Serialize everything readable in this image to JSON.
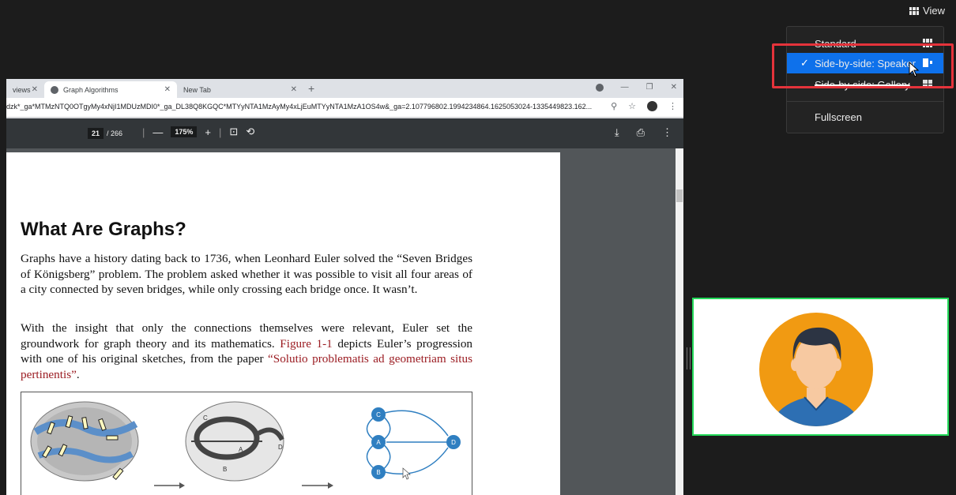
{
  "view_button": {
    "label": "View"
  },
  "view_menu": {
    "items": [
      {
        "label": "Standard"
      },
      {
        "label": "Side-by-side: Speaker",
        "checked": true
      },
      {
        "label": "Side-by-side: Gallery"
      },
      {
        "label": "Fullscreen"
      }
    ],
    "check_mark": "✓",
    "accent_color": "#0e71eb",
    "highlight_color": "#e5333b"
  },
  "browser": {
    "tabs": [
      {
        "label": "views"
      },
      {
        "label": "Graph Algorithms",
        "active": true
      },
      {
        "label": "New Tab"
      }
    ],
    "url": "dzk*_ga*MTMzNTQ0OTgyMy4xNjI1MDUzMDI0*_ga_DL38Q8KGQC*MTYyNTA1MzAyMy4xLjEuMTYyNTA1MzA1OS4w&_ga=2.107796802.1994234864.1625053024-1335449823.162..."
  },
  "pdf_toolbar": {
    "current_page": "21",
    "total_pages": "/ 266",
    "zoom": "175%"
  },
  "document": {
    "heading": "What Are Graphs?",
    "paragraph1": "Graphs have a history dating back to 1736, when Leonhard Euler solved the “Seven Bridges of Königsberg” problem. The problem asked whether it was possible to visit all four areas of a city connected by seven bridges, while only crossing each bridge once. It wasn’t.",
    "paragraph2_a": "With the insight that only the connections themselves were relevant, Euler set the groundwork for graph theory and its mathematics. ",
    "paragraph2_link1": "Figure 1-1",
    "paragraph2_b": " depicts Euler’s progression with one of his original sketches, from the paper ",
    "paragraph2_link2": "“Solutio problematis ad geometriam situs pertinentis”",
    "paragraph2_c": ".",
    "figure_nodes": [
      "C",
      "A",
      "D",
      "B"
    ],
    "map_labels": [
      "A",
      "B",
      "C",
      "D"
    ]
  },
  "colors": {
    "node_fill": "#2f7fc1",
    "link_red": "#9b1c22",
    "video_border": "#23d959",
    "avatar_bg": "#f19a12",
    "shirt": "#2d6fb3"
  }
}
